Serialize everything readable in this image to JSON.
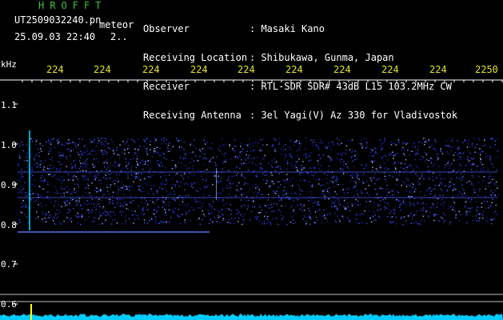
{
  "header": {
    "app_title": "HROFFT",
    "file_name": "UT2509032240.pn",
    "file_suffix": "meteor",
    "datetime": "25.09.03 22:40",
    "truncated_value": "2.."
  },
  "info": {
    "observer_label": "Observer",
    "observer_value": ": Masaki Kano",
    "location_label": "Receiving Location",
    "location_value": ": Shibukawa, Gunma, Japan",
    "receiver_label": "Receiver",
    "receiver_value": ": RTL-SDR SDR# 43dB L15 103.2MHz CW",
    "antenna_label": "Receiving Antenna",
    "antenna_value": ": 3el Yagi(V) Az 330 for Vladivostok"
  },
  "spectrogram": {
    "y_unit": "kHz",
    "x_ticks": [
      "224",
      "224",
      "224",
      "224",
      "224",
      "224",
      "224",
      "224",
      "224",
      "2250"
    ],
    "y_ticks": [
      "1.1",
      "1.0",
      "0.9",
      "0.8",
      "0.7",
      "0.6"
    ],
    "colors": {
      "background": "#000000",
      "signal": "#2840ff",
      "trace": "#00ccff",
      "tick_text": "#e6e61e",
      "title": "#3ec43e"
    }
  }
}
